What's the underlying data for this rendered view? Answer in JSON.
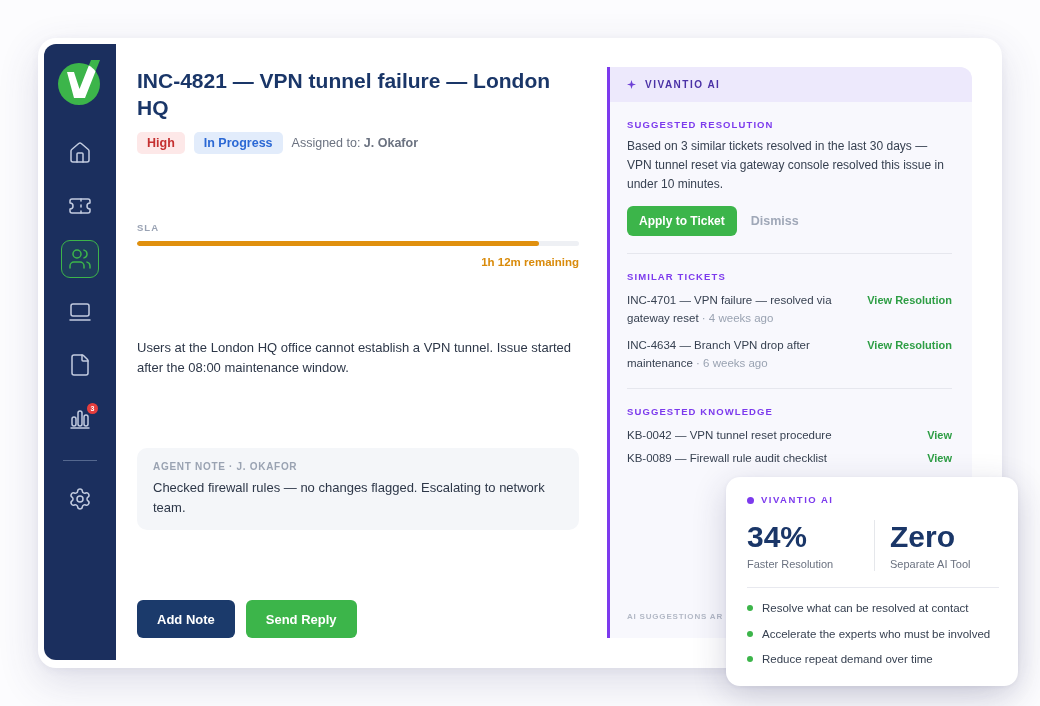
{
  "sidebar": {
    "items": [
      {
        "selected": false
      },
      {
        "selected": false
      },
      {
        "selected": true
      },
      {
        "selected": false
      },
      {
        "selected": false
      },
      {
        "selected": false,
        "badge": "3"
      }
    ],
    "footer_items": [
      {
        "selected": false
      }
    ]
  },
  "ticket": {
    "title": "INC-4821 — VPN tunnel failure — London HQ",
    "tags": [
      {
        "label": "High",
        "kind": "priority"
      },
      {
        "label": "In Progress",
        "kind": "status"
      }
    ],
    "assignee": "Assigned to: **J. Okafor**",
    "sla": {
      "label": "SLA",
      "level": 0.91,
      "remaining": "1h 12m remaining"
    },
    "description": "Users at the London HQ office cannot establish a VPN tunnel. Issue started after the 08:00 maintenance window.",
    "note": {
      "header": "AGENT NOTE · J. OKAFOR",
      "text": "Checked firewall rules — no changes flagged. Escalating to network team."
    },
    "actions": [
      {
        "label": "Add Note",
        "kind": "secondary"
      },
      {
        "label": "Send Reply",
        "kind": "primary"
      }
    ]
  },
  "ai_panel": {
    "title": "VIVANTIO AI",
    "resolution": {
      "heading": "SUGGESTED RESOLUTION",
      "text": "Based on 3 similar tickets resolved in the last 30 days — VPN tunnel reset via gateway console resolved this issue in under 10 minutes.",
      "actions": [
        {
          "label": "Apply to Ticket",
          "kind": "primary"
        },
        {
          "label": "Dismiss",
          "kind": "link"
        }
      ]
    },
    "similar_tickets": {
      "heading": "SIMILAR TICKETS",
      "items": [
        {
          "title": "INC-4701 — VPN failure — resolved via gateway reset",
          "age": "· 4 weeks ago",
          "action": "View Resolution"
        },
        {
          "title": "INC-4634 — Branch VPN drop after maintenance",
          "age": "· 6 weeks ago",
          "action": "View Resolution"
        }
      ]
    },
    "knowledge": {
      "heading": "SUGGESTED KNOWLEDGE",
      "items": [
        {
          "title": "KB-0042 — VPN tunnel reset procedure",
          "action": "View"
        },
        {
          "title": "KB-0089 — Firewall rule audit checklist",
          "action": "View"
        }
      ]
    },
    "footer": "AI SUGGESTIONS AR"
  },
  "summary_card": {
    "title": "VIVANTIO AI",
    "stats": [
      {
        "value": "34%",
        "label": "Faster Resolution"
      },
      {
        "value": "Zero",
        "label": "Separate AI Tool"
      }
    ],
    "points": [
      "Resolve what can be resolved at contact",
      "Accelerate the experts who must be involved",
      "Reduce repeat demand over time"
    ]
  }
}
